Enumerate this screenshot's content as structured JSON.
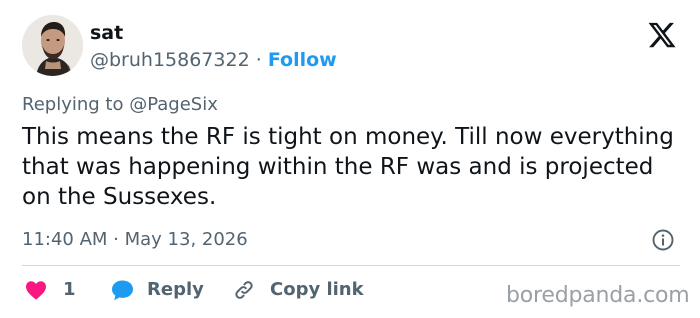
{
  "author": {
    "display_name": "sat",
    "handle": "@bruh15867322",
    "separator": "·",
    "follow_label": "Follow"
  },
  "reply_context": "Replying to @PageSix",
  "tweet": {
    "text": "This means the RF is tight on money. Till now everything that was happening within the RF was and is projected on the Sussexes.",
    "timestamp": "11:40 AM · May 13, 2026"
  },
  "actions": {
    "like_count": "1",
    "reply_label": "Reply",
    "copy_link_label": "Copy link"
  },
  "watermark": "boredpanda.com",
  "colors": {
    "accent": "#1d9bf0",
    "like": "#f91880",
    "muted": "#536471",
    "divider": "#cfd9de"
  }
}
